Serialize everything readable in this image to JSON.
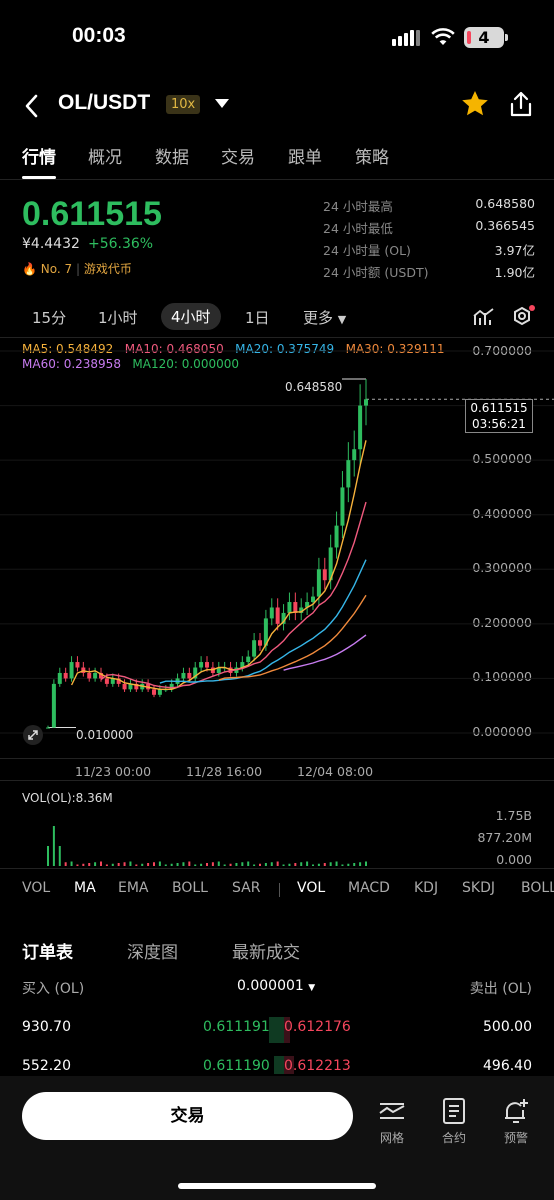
{
  "status_bar": {
    "time": "00:03",
    "battery": "4"
  },
  "header": {
    "pair": "OL/USDT",
    "leverage": "10x"
  },
  "tabs": [
    "行情",
    "概况",
    "数据",
    "交易",
    "跟单",
    "策略"
  ],
  "ticker": {
    "last_price": "0.611515",
    "cny_price": "¥4.4432",
    "change": "+56.36%",
    "rank": "No. 7",
    "category": "游戏代币",
    "stats": [
      {
        "label": "24 小时最高",
        "value": "0.648580"
      },
      {
        "label": "24 小时最低",
        "value": "0.366545"
      },
      {
        "label": "24 小时量 (OL)",
        "value": "3.97亿"
      },
      {
        "label": "24 小时额 (USDT)",
        "value": "1.90亿"
      }
    ]
  },
  "intervals": [
    "15分",
    "1小时",
    "4小时",
    "1日",
    "更多"
  ],
  "ma_values": {
    "ma5": "MA5: 0.548492",
    "ma10": "MA10: 0.468050",
    "ma20": "MA20: 0.375749",
    "ma30": "MA30: 0.329111",
    "ma60": "MA60: 0.238958",
    "ma120": "MA120: 0.000000"
  },
  "colors": {
    "ma5": "#f7b23b",
    "ma10": "#f05a7e",
    "ma20": "#36b6e8",
    "ma30": "#f08a3c",
    "ma60": "#c77cf0",
    "ma120": "#2ebd5f",
    "up": "#2ebd5f",
    "down": "#f6465d"
  },
  "chart_data": {
    "type": "candlestick",
    "y_axis_ticks": [
      "0.700000",
      "0.600000",
      "0.500000",
      "0.400000",
      "0.300000",
      "0.200000",
      "0.100000",
      "0.000000"
    ],
    "x_axis_ticks": [
      "11/23 00:00",
      "11/28 16:00",
      "12/04 08:00"
    ],
    "high_label": "0.648580",
    "low_label": "0.010000",
    "current_price_tag": "0.611515",
    "countdown": "03:56:21",
    "ylim": [
      0,
      0.7
    ],
    "closes": [
      0.01,
      0.09,
      0.11,
      0.1,
      0.13,
      0.12,
      0.11,
      0.1,
      0.11,
      0.1,
      0.09,
      0.1,
      0.09,
      0.08,
      0.09,
      0.08,
      0.09,
      0.08,
      0.07,
      0.08,
      0.08,
      0.09,
      0.1,
      0.11,
      0.1,
      0.12,
      0.13,
      0.12,
      0.11,
      0.12,
      0.12,
      0.11,
      0.12,
      0.13,
      0.14,
      0.17,
      0.16,
      0.21,
      0.23,
      0.2,
      0.22,
      0.24,
      0.22,
      0.23,
      0.24,
      0.25,
      0.3,
      0.28,
      0.34,
      0.38,
      0.45,
      0.5,
      0.52,
      0.6,
      0.6115
    ]
  },
  "volume": {
    "label": "VOL(OL):8.36M",
    "ticks": [
      "1.75B",
      "877.20M",
      "0.000"
    ]
  },
  "indicators_left": [
    "VOL",
    "MA",
    "EMA",
    "BOLL",
    "SAR"
  ],
  "indicators_right": [
    "VOL",
    "MACD",
    "KDJ",
    "SKDJ",
    "BOLL"
  ],
  "orderbook": {
    "tabs": [
      "订单表",
      "深度图",
      "最新成交"
    ],
    "bid_header": "买入 (OL)",
    "precision": "0.000001",
    "ask_header": "卖出 (OL)",
    "rows": [
      {
        "bid_qty": "930.70",
        "bid_price": "0.611191",
        "ask_price": "0.612176",
        "ask_qty": "500.00"
      },
      {
        "bid_qty": "552.20",
        "bid_price": "0.611190",
        "ask_price": "0.612213",
        "ask_qty": "496.40"
      }
    ]
  },
  "bottom_bar": {
    "trade": "交易",
    "grid": "网格",
    "contract": "合约",
    "alert": "预警"
  }
}
